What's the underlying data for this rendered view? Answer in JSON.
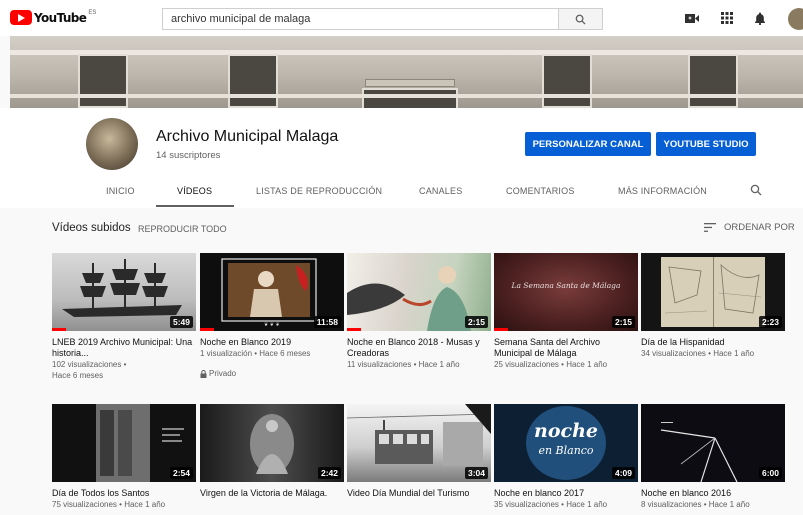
{
  "topbar": {
    "logo_text": "YouTube",
    "country_code": "ES",
    "search_value": "archivo municipal de malaga",
    "icons": [
      "search-icon",
      "video-camera-icon",
      "apps-grid-icon",
      "bell-icon"
    ]
  },
  "channel": {
    "name": "Archivo Municipal Malaga",
    "subscribers": "14 suscriptores",
    "customize_label": "PERSONALIZAR CANAL",
    "studio_label": "YOUTUBE STUDIO"
  },
  "tabs": [
    {
      "label": "INICIO",
      "active": false
    },
    {
      "label": "VÍDEOS",
      "active": true
    },
    {
      "label": "LISTAS DE REPRODUCCIÓN",
      "active": false
    },
    {
      "label": "CANALES",
      "active": false
    },
    {
      "label": "COMENTARIOS",
      "active": false
    },
    {
      "label": "MÁS INFORMACIÓN",
      "active": false
    }
  ],
  "section": {
    "title": "Vídeos subidos",
    "play_all": "REPRODUCIR TODO",
    "sort_label": "ORDENAR POR"
  },
  "videos": [
    {
      "title": "LNEB 2019 Archivo Municipal: Una historia...",
      "duration": "5:49",
      "views": "102 visualizaciones •",
      "age": "Hace 6 meses",
      "progress": 0.1
    },
    {
      "title": "Noche en Blanco 2019",
      "duration": "11:58",
      "views": "1 visualización",
      "age": "Hace 6 meses",
      "privacy": "Privado",
      "progress": 0.1
    },
    {
      "title": "Noche en Blanco 2018 - Musas y Creadoras",
      "duration": "2:15",
      "views": "11 visualizaciones",
      "age": "Hace 1 año",
      "progress": 0.1
    },
    {
      "title": "Semana Santa del Archivo Municipal de Málaga",
      "duration": "2:15",
      "views": "25 visualizaciones",
      "age": "Hace 1 año",
      "progress": 0.1
    },
    {
      "title": "Día de la Hispanidad",
      "duration": "2:23",
      "views": "34 visualizaciones",
      "age": "Hace 1 año",
      "progress": 0
    },
    {
      "title": "Día de Todos los Santos",
      "duration": "2:54",
      "views": "75 visualizaciones",
      "age": "Hace 1 año",
      "progress": 0
    },
    {
      "title": "Virgen de la Victoria de Málaga.",
      "duration": "2:42",
      "views": "",
      "age": "",
      "progress": 0
    },
    {
      "title": "Video Día Mundial del Turismo",
      "duration": "3:04",
      "views": "",
      "age": "",
      "progress": 0
    },
    {
      "title": "Noche en blanco 2017",
      "duration": "4:09",
      "views": "35 visualizaciones",
      "age": "Hace 1 año",
      "progress": 0
    },
    {
      "title": "Noche en blanco 2016",
      "duration": "6:00",
      "views": "8 visualizaciones",
      "age": "Hace 1 año",
      "progress": 0
    }
  ],
  "thumb_texts": {
    "semana_santa": "La Semana Santa de Málaga",
    "noche_2017_line1": "noche",
    "noche_2017_line2": "en Blanco"
  },
  "colors": {
    "brand_red": "#ff0000",
    "button_blue": "#065fd4",
    "progress_red": "#ff0000"
  }
}
